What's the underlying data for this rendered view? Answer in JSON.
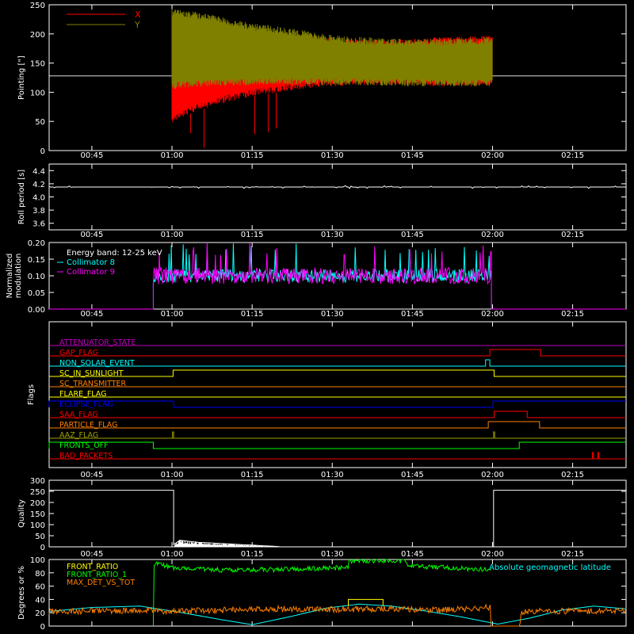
{
  "colors": {
    "background": "#000000",
    "axes": "#ffffff",
    "red": "#ff0000",
    "olive": "#808000",
    "cyan": "#00ffff",
    "magenta": "#ff00ff",
    "green": "#00ff00",
    "orange": "#ff8000",
    "yellow": "#ffff00",
    "blue": "#0000ff",
    "purple": "#c000c0",
    "olive_yellow": "#a0a000"
  },
  "x_ticks": [
    "00:45",
    "01:00",
    "01:15",
    "01:30",
    "01:45",
    "02:00",
    "02:15"
  ],
  "x_tick_minutes": [
    45,
    60,
    75,
    90,
    105,
    120,
    135
  ],
  "x_range_minutes": [
    37,
    145
  ],
  "chart_data": [
    {
      "type": "line",
      "id": "pointing",
      "ylabel": "Pointing [\"]",
      "ylim": [
        0,
        250
      ],
      "yticks": [
        "0",
        "50",
        "100",
        "150",
        "200",
        "250"
      ],
      "yticks_values": [
        0,
        50,
        100,
        150,
        200,
        250
      ],
      "legend": [
        "X",
        "Y"
      ],
      "reference_line": 128,
      "series": [
        {
          "name": "X",
          "color": "#ff0000",
          "x_minutes": [
            60,
            63,
            67,
            71,
            75,
            80,
            85,
            90,
            95,
            100,
            105,
            110,
            115,
            120
          ],
          "upper": [
            215,
            213,
            210,
            206,
            203,
            200,
            197,
            193,
            191,
            190,
            192,
            195,
            196,
            197
          ],
          "lower": [
            48,
            62,
            75,
            85,
            93,
            100,
            106,
            110,
            112,
            112,
            111,
            110,
            110,
            110
          ],
          "spikes": [
            {
              "x": 63.5,
              "y": 30
            },
            {
              "x": 66,
              "y": 5
            },
            {
              "x": 75.5,
              "y": 28
            },
            {
              "x": 78,
              "y": 32
            },
            {
              "x": 79.5,
              "y": 38
            }
          ]
        },
        {
          "name": "Y",
          "color": "#808000",
          "x_minutes": [
            60,
            63,
            67,
            71,
            75,
            80,
            85,
            90,
            95,
            100,
            105,
            110,
            115,
            120
          ],
          "upper": [
            243,
            240,
            234,
            226,
            218,
            213,
            206,
            198,
            195,
            193,
            192,
            192,
            193,
            195
          ],
          "lower": [
            105,
            108,
            110,
            111,
            112,
            113,
            113,
            112,
            112,
            111,
            110,
            110,
            110,
            110
          ]
        }
      ]
    },
    {
      "type": "line",
      "id": "roll",
      "ylabel": "Roll period [s]",
      "ylim": [
        3.5,
        4.5
      ],
      "yticks": [
        "3.6",
        "3.8",
        "4.0",
        "4.2",
        "4.4"
      ],
      "yticks_values": [
        3.6,
        3.8,
        4.0,
        4.2,
        4.4
      ],
      "series": [
        {
          "name": "",
          "color": "#ffffff",
          "x_minutes": [
            37,
            145
          ],
          "y": [
            4.15,
            4.15
          ]
        }
      ]
    },
    {
      "type": "line",
      "id": "modulation",
      "ylabel": "Normalized modulation",
      "ylim": [
        0,
        0.2
      ],
      "yticks": [
        "0.00",
        "0.05",
        "0.10",
        "0.15",
        "0.20"
      ],
      "yticks_values": [
        0,
        0.05,
        0.1,
        0.15,
        0.2
      ],
      "annotation": "Energy band: 12-25 keV",
      "legend": [
        "Collimator 8",
        "Collimator 9"
      ],
      "active_range_minutes": [
        56.5,
        119.8
      ],
      "series": [
        {
          "name": "Collimator 8",
          "color": "#00ffff",
          "baseline": 0.1,
          "spread": 0.02
        },
        {
          "name": "Collimator 9",
          "color": "#ff00ff",
          "baseline": 0.1,
          "spread": 0.025
        }
      ]
    },
    {
      "type": "line",
      "id": "flags",
      "ylabel": "Flags",
      "series": [
        {
          "name": "ATTENUATOR_STATE",
          "color": "#c000c0",
          "steps": []
        },
        {
          "name": "GAP_FLAG",
          "color": "#ff0000",
          "steps": [
            [
              119.5,
              129
            ]
          ]
        },
        {
          "name": "NON_SOLAR_EVENT",
          "color": "#00ffff",
          "steps": [
            [
              118.7,
              119.5
            ]
          ]
        },
        {
          "name": "SC_IN_SUNLIGHT",
          "color": "#ffff00",
          "steps": [
            [
              60.2,
              120.3
            ]
          ]
        },
        {
          "name": "SC_TRANSMITTER",
          "color": "#ff8000",
          "steps": []
        },
        {
          "name": "FLARE_FLAG",
          "color": "#ffff00",
          "steps": []
        },
        {
          "name": "ECLIPSE_FLAG",
          "color": "#0000ff",
          "steps": [
            [
              37,
              60.3
            ],
            [
              120.1,
              145
            ]
          ]
        },
        {
          "name": "SAA_FLAG",
          "color": "#ff0000",
          "steps": [
            [
              120.3,
              126.5
            ]
          ]
        },
        {
          "name": "PARTICLE_FLAG",
          "color": "#ff8000",
          "steps": [
            [
              119.2,
              128.8
            ]
          ]
        },
        {
          "name": "AAZ_FLAG",
          "color": "#a0a000",
          "steps": [
            [
              60.1,
              60.3
            ],
            [
              120.2,
              120.4
            ]
          ]
        },
        {
          "name": "FRONTS_OFF",
          "color": "#00ff00",
          "steps": [
            [
              37,
              56.5
            ],
            [
              125,
              145
            ]
          ]
        },
        {
          "name": "BAD_PACKETS",
          "color": "#ff0000",
          "steps": [
            [
              138.7,
              138.9
            ],
            [
              139.7,
              139.9
            ]
          ]
        }
      ]
    },
    {
      "type": "line",
      "id": "quality",
      "ylabel": "Quality",
      "ylim": [
        0,
        300
      ],
      "yticks": [
        "0",
        "50",
        "100",
        "150",
        "200",
        "250",
        "300"
      ],
      "yticks_values": [
        0,
        50,
        100,
        150,
        200,
        250,
        300
      ],
      "series": [
        {
          "name": "",
          "color": "#ffffff",
          "x_minutes": [
            37,
            60.3,
            60.3,
            61.5,
            63,
            65,
            67,
            69,
            71,
            73,
            75,
            77,
            79,
            80,
            80,
            120.2,
            120.2,
            145
          ],
          "y": [
            255,
            255,
            10,
            30,
            25,
            20,
            18,
            15,
            13,
            10,
            8,
            5,
            3,
            1,
            0,
            0,
            255,
            255
          ]
        }
      ]
    },
    {
      "type": "line",
      "id": "ratio",
      "ylabel": "Degrees or %",
      "ylim": [
        0,
        100
      ],
      "yticks": [
        "0",
        "20",
        "40",
        "60",
        "80",
        "100"
      ],
      "yticks_values": [
        0,
        20,
        40,
        60,
        80,
        100
      ],
      "legend": [
        "FRONT_RATIO",
        "FRONT_RATIO_1",
        "MAX_DET_VS_TOT"
      ],
      "annotation": "Absolute geomagnetic latitude",
      "series": [
        {
          "name": "FRONT_RATIO",
          "color": "#ffff00",
          "x_minutes": [
            93,
            93,
            99.5,
            99.5
          ],
          "y": [
            30,
            40,
            40,
            30
          ]
        },
        {
          "name": "FRONT_RATIO_1",
          "color": "#00ff00",
          "x_minutes": [
            56.5,
            56.5,
            60,
            70,
            80,
            93,
            93,
            104,
            104,
            112,
            119.7,
            119.7
          ],
          "y": [
            0,
            95,
            88,
            84,
            85,
            88,
            98,
            98,
            90,
            88,
            84,
            0
          ]
        },
        {
          "name": "MAX_DET_VS_TOT",
          "color": "#ff8000",
          "x_minutes": [
            37,
            56,
            60,
            80,
            90,
            100,
            110,
            119.6,
            119.7,
            125,
            125.5,
            145
          ],
          "y": [
            22,
            24,
            22,
            26,
            25,
            26,
            24,
            28,
            0,
            0,
            22,
            23
          ]
        },
        {
          "name": "Absolute geomagnetic latitude",
          "color": "#00ffff",
          "x_minutes": [
            37,
            45,
            54,
            62,
            69,
            75,
            82,
            89,
            95,
            101,
            108,
            114,
            121,
            127,
            133,
            139,
            145
          ],
          "y": [
            22,
            28,
            30,
            20,
            10,
            2,
            14,
            27,
            33,
            30,
            22,
            14,
            3,
            12,
            24,
            30,
            26
          ]
        }
      ]
    }
  ]
}
